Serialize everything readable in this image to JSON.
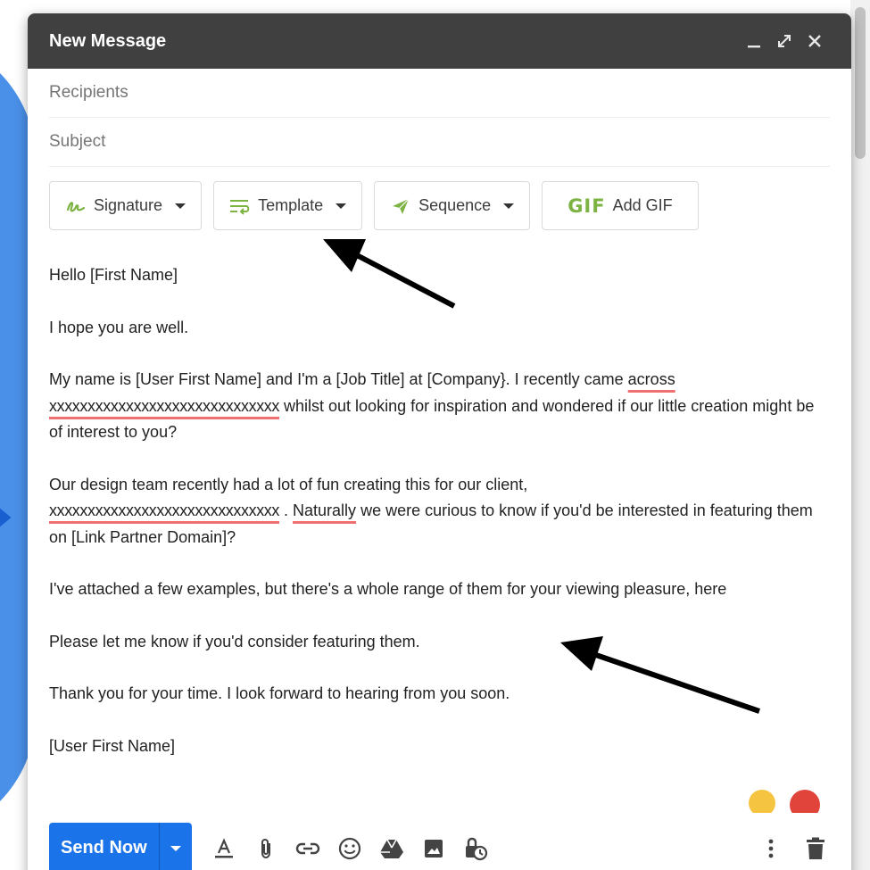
{
  "compose": {
    "title": "New Message",
    "recipients_placeholder": "Recipients",
    "subject_placeholder": "Subject"
  },
  "extension_toolbar": {
    "signature_label": "Signature",
    "template_label": "Template",
    "sequence_label": "Sequence",
    "gif_icon_text": "GIF",
    "add_gif_label": "Add GIF"
  },
  "message": {
    "greeting": "Hello [First Name]",
    "line1": "I hope you are well.",
    "p2_a": "My name is [User First Name] and I'm a [Job Title] at [Company}. I recently came ",
    "p2_across": "across",
    "p2_b": " ",
    "p2_xx": "xxxxxxxxxxxxxxxxxxxxxxxxxxxxxx",
    "p2_c": " whilst out looking for inspiration and wondered if our little creation might be of interest to you?",
    "p3_a": "Our design team recently had a lot of fun creating this for our client, ",
    "p3_xx": "xxxxxxxxxxxxxxxxxxxxxxxxxxxxxx",
    "p3_b": " . ",
    "p3_naturally": "Naturally",
    "p3_c": " we were curious to know if you'd be interested in featuring them on [Link Partner Domain]?",
    "p4": "I've attached a few examples, but there's a whole range of them for your viewing pleasure, here",
    "p5": "Please let me know if you'd consider featuring them.",
    "p6": "Thank you for your time. I look forward to hearing from you soon.",
    "signoff": "[User First Name]"
  },
  "bottom_toolbar": {
    "send_label": "Send Now"
  },
  "colors": {
    "titlebar": "#404040",
    "send_button": "#1a73e8",
    "spellcheck_underline": "#f07070",
    "extension_green": "#7cb342",
    "backdrop_blue": "#4a90e8"
  },
  "icons": [
    "minimize-icon",
    "expand-icon",
    "close-icon",
    "signature-icon",
    "template-icon",
    "sequence-icon",
    "formatting-icon",
    "attach-icon",
    "link-icon",
    "emoji-icon",
    "drive-icon",
    "photo-icon",
    "confidential-icon",
    "more-options-icon",
    "trash-icon"
  ]
}
